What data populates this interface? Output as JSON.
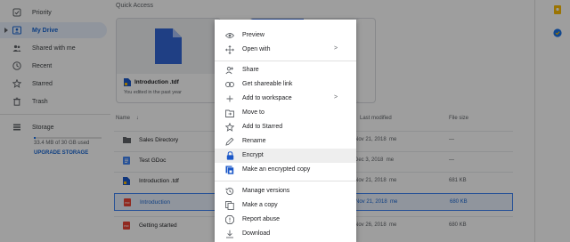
{
  "sidebar": {
    "items": [
      {
        "label": "Priority",
        "icon": "priority-icon"
      },
      {
        "label": "My Drive",
        "icon": "my-drive-icon"
      },
      {
        "label": "Shared with me",
        "icon": "shared-icon"
      },
      {
        "label": "Recent",
        "icon": "clock-icon"
      },
      {
        "label": "Starred",
        "icon": "star-icon"
      },
      {
        "label": "Trash",
        "icon": "trash-icon"
      }
    ],
    "storage_label": "Storage",
    "storage_used": "33.4 MB of 30 GB used",
    "storage_fraction": 0.02,
    "upgrade_label": "UPGRADE STORAGE"
  },
  "quick_access": {
    "title": "Quick Access",
    "cards": [
      {
        "name": "Introduction .tdf",
        "subtitle": "You edited in the past year"
      }
    ]
  },
  "file_list": {
    "columns": {
      "name": "Name",
      "last_modified": "Last modified",
      "file_size": "File size"
    },
    "rows": [
      {
        "name": "Sales Directory",
        "modified": "Nov 21, 2018",
        "by": "me",
        "size": "—",
        "type": "folder"
      },
      {
        "name": "Test GDoc",
        "modified": "Dec 3, 2018",
        "by": "me",
        "size": "—",
        "type": "doc"
      },
      {
        "name": "Introduction .tdf",
        "modified": "Nov 21, 2018",
        "by": "me",
        "size": "681 KB",
        "type": "tdf"
      },
      {
        "name": "Introduction",
        "modified": "Nov 21, 2018",
        "by": "me",
        "size": "680 KB",
        "type": "pdf",
        "selected": true
      },
      {
        "name": "Getting started",
        "modified": "Nov 26, 2018",
        "by": "me",
        "size": "680 KB",
        "type": "pdf"
      }
    ]
  },
  "context_menu": {
    "items": [
      {
        "label": "Preview",
        "icon": "eye-icon"
      },
      {
        "label": "Open with",
        "icon": "open-with-icon",
        "submenu": ">"
      },
      {
        "label": "Share",
        "icon": "share-person-icon"
      },
      {
        "label": "Get shareable link",
        "icon": "link-icon"
      },
      {
        "label": "Add to workspace",
        "icon": "plus-icon",
        "submenu": ">"
      },
      {
        "label": "Move to",
        "icon": "move-folder-icon"
      },
      {
        "label": "Add to Starred",
        "icon": "star-outline-icon"
      },
      {
        "label": "Rename",
        "icon": "pencil-icon"
      },
      {
        "label": "Encrypt",
        "icon": "lock-icon"
      },
      {
        "label": "Make an encrypted copy",
        "icon": "encrypted-copy-icon"
      },
      {
        "label": "Manage versions",
        "icon": "history-icon"
      },
      {
        "label": "Make a copy",
        "icon": "copy-icon"
      },
      {
        "label": "Report abuse",
        "icon": "report-icon"
      },
      {
        "label": "Download",
        "icon": "download-icon"
      }
    ]
  },
  "colors": {
    "accent": "#1a73e8",
    "pdf_red": "#ea4335",
    "doc_blue": "#4285f4",
    "tdf_blue": "#1a57c8",
    "keep_yellow": "#fbbc04"
  }
}
